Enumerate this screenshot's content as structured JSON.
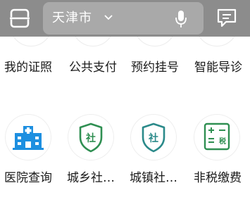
{
  "header": {
    "city": "天津市",
    "icons": {
      "scan": "scan-icon",
      "dropdown": "chevron-down-icon",
      "voice": "microphone-icon",
      "message": "message-icon"
    }
  },
  "row1": {
    "items": [
      {
        "label": "我的证照"
      },
      {
        "label": "公共支付"
      },
      {
        "label": "预约挂号"
      },
      {
        "label": "智能导诊"
      }
    ]
  },
  "row2": {
    "items": [
      {
        "label": "医院查询",
        "icon": "hospital-icon"
      },
      {
        "label": "城乡社…",
        "icon": "shield-she-icon",
        "glyph": "社"
      },
      {
        "label": "城镇社…",
        "icon": "shield-she-icon",
        "glyph": "社"
      },
      {
        "label": "非税缴费",
        "icon": "tax-calculator-icon",
        "glyph": "税"
      }
    ]
  },
  "colors": {
    "header_bg": "#8c8c8c",
    "search_bg": "#a9a9a9",
    "green": "#2f8f52",
    "teal": "#2b8a8a",
    "blue": "#1d8fe0"
  }
}
